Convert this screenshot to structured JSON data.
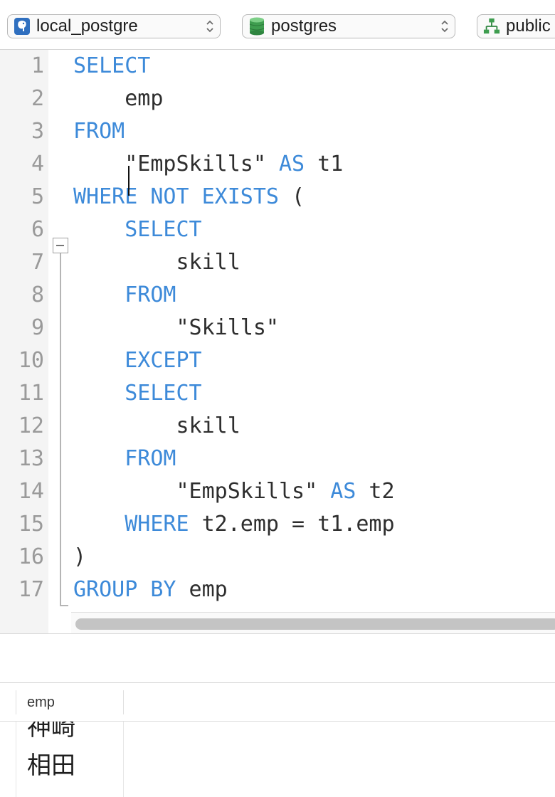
{
  "toolbar": {
    "connection": {
      "label": "local_postgre",
      "icon": "postgres-elephant-icon"
    },
    "database": {
      "label": "postgres",
      "icon": "database-cylinder-icon"
    },
    "schema": {
      "label": "public",
      "icon": "schema-tree-icon"
    }
  },
  "editor": {
    "line_numbers": [
      "1",
      "2",
      "3",
      "4",
      "5",
      "6",
      "7",
      "8",
      "9",
      "10",
      "11",
      "12",
      "13",
      "14",
      "15",
      "16",
      "17"
    ],
    "lines": [
      [
        {
          "t": "SELECT",
          "k": true
        }
      ],
      [
        {
          "t": "    emp",
          "k": false
        }
      ],
      [
        {
          "t": "FROM",
          "k": true
        }
      ],
      [
        {
          "t": "    \"EmpSkills\" ",
          "k": false
        },
        {
          "t": "AS",
          "k": true
        },
        {
          "t": " t1",
          "k": false
        }
      ],
      [
        {
          "t": "WHERE NOT EXISTS",
          "k": true
        },
        {
          "t": " (",
          "k": false
        }
      ],
      [
        {
          "t": "    ",
          "k": false
        },
        {
          "t": "SELECT",
          "k": true
        }
      ],
      [
        {
          "t": "        skill",
          "k": false
        }
      ],
      [
        {
          "t": "    ",
          "k": false
        },
        {
          "t": "FROM",
          "k": true
        }
      ],
      [
        {
          "t": "        \"Skills\"",
          "k": false
        }
      ],
      [
        {
          "t": "    ",
          "k": false
        },
        {
          "t": "EXCEPT",
          "k": true
        }
      ],
      [
        {
          "t": "    ",
          "k": false
        },
        {
          "t": "SELECT",
          "k": true
        }
      ],
      [
        {
          "t": "        skill",
          "k": false
        }
      ],
      [
        {
          "t": "    ",
          "k": false
        },
        {
          "t": "FROM",
          "k": true
        }
      ],
      [
        {
          "t": "        \"EmpSkills\" ",
          "k": false
        },
        {
          "t": "AS",
          "k": true
        },
        {
          "t": " t2",
          "k": false
        }
      ],
      [
        {
          "t": "    ",
          "k": false
        },
        {
          "t": "WHERE",
          "k": true
        },
        {
          "t": " t2.emp = t1.emp",
          "k": false
        }
      ],
      [
        {
          "t": ")",
          "k": false
        }
      ],
      [
        {
          "t": "GROUP BY",
          "k": true
        },
        {
          "t": " emp",
          "k": false
        }
      ]
    ],
    "colors": {
      "keyword": "#3d8ad9",
      "text": "#2e2e2e",
      "line_number": "#9a9a9a"
    }
  },
  "results": {
    "columns": [
      "emp"
    ],
    "rows": [
      "神崎",
      "相田"
    ]
  }
}
